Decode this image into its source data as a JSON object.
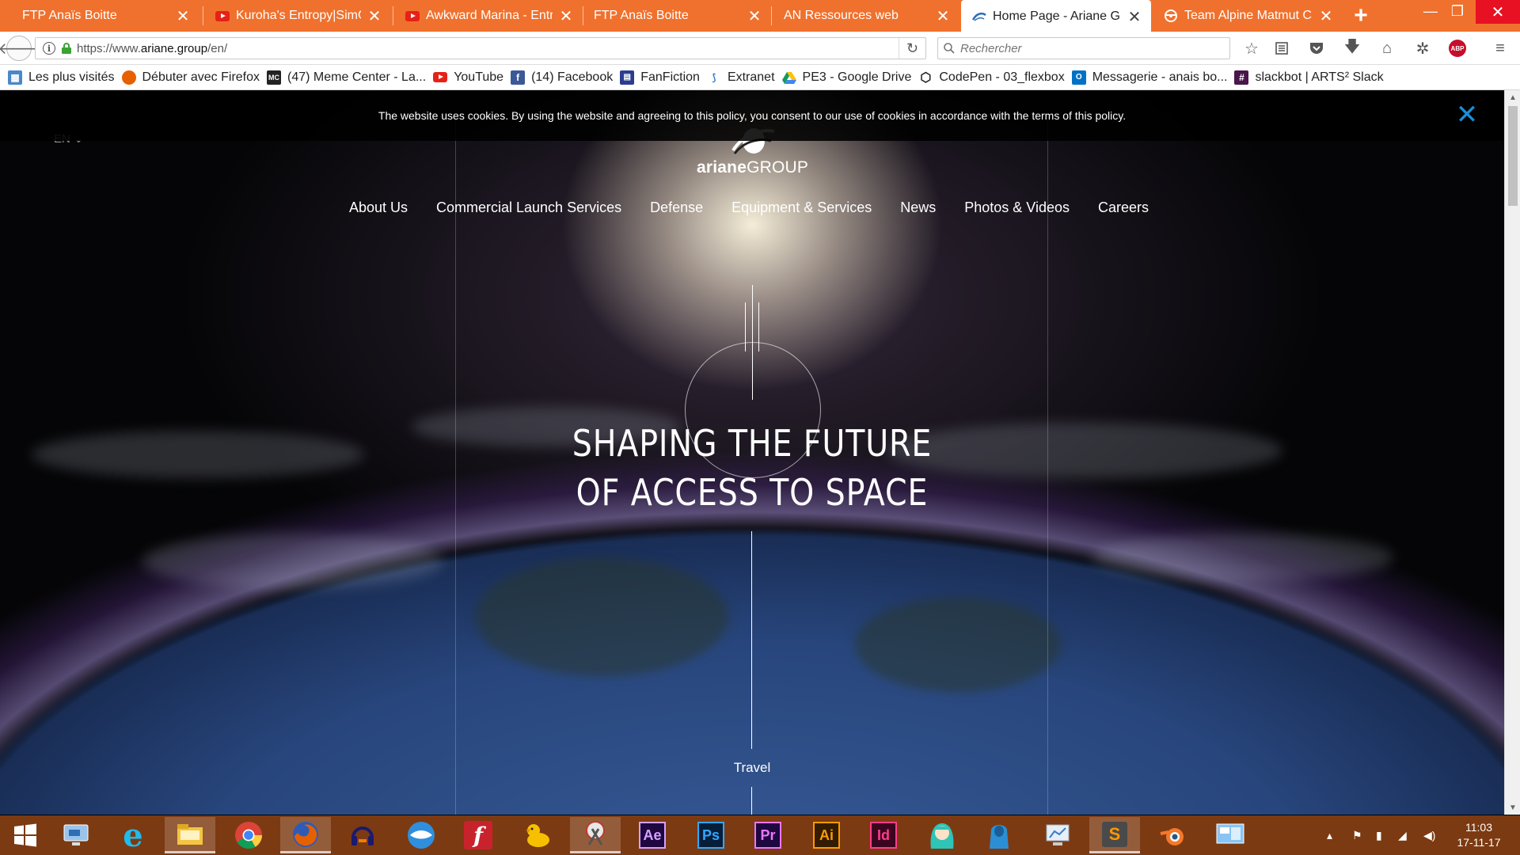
{
  "browser": {
    "tabs": [
      {
        "title": "FTP Anaïs Boitte",
        "favicon": "none"
      },
      {
        "title": "Kuroha's Entropy|SimGr",
        "favicon": "youtube-icon"
      },
      {
        "title": "Awkward Marina - Entro",
        "favicon": "youtube-icon"
      },
      {
        "title": "FTP Anaïs Boitte",
        "favicon": "none"
      },
      {
        "title": "AN Ressources web",
        "favicon": "none"
      },
      {
        "title": "Home Page - Ariane Gro",
        "favicon": "ariane-icon",
        "active": true
      },
      {
        "title": "Team Alpine Matmut Ch",
        "favicon": "steering-wheel-icon"
      }
    ],
    "url_prefix": "https://www.",
    "url_host": "ariane.group",
    "url_path": "/en/",
    "search_placeholder": "Rechercher",
    "bookmarks": [
      {
        "label": "Les plus visités",
        "icon": "most-visited-icon"
      },
      {
        "label": "Débuter avec Firefox",
        "icon": "firefox-icon"
      },
      {
        "label": "(47) Meme Center - La...",
        "icon": "memecenter-icon"
      },
      {
        "label": "YouTube",
        "icon": "youtube-icon"
      },
      {
        "label": "(14) Facebook",
        "icon": "facebook-icon"
      },
      {
        "label": "FanFiction",
        "icon": "fanfiction-icon"
      },
      {
        "label": "Extranet",
        "icon": "extranet-icon"
      },
      {
        "label": "PE3 - Google Drive",
        "icon": "google-drive-icon"
      },
      {
        "label": "CodePen - 03_flexbox",
        "icon": "codepen-icon"
      },
      {
        "label": "Messagerie - anais bo...",
        "icon": "outlook-icon"
      },
      {
        "label": "slackbot | ARTS² Slack",
        "icon": "slack-icon"
      }
    ]
  },
  "page": {
    "cookie_text": "The website uses cookies. By using the website and agreeing to this policy, you consent to our use of cookies in accordance with the terms of this policy.",
    "lang": "EN",
    "logo_bold": "ariane",
    "logo_thin": "GROUP",
    "nav": [
      "About Us",
      "Commercial Launch Services",
      "Defense",
      "Equipment & Services",
      "News",
      "Photos & Videos",
      "Careers"
    ],
    "hero_line1": "SHAPING THE FUTURE",
    "hero_line2": "OF ACCESS TO SPACE",
    "travel_label": "Travel"
  },
  "taskbar": {
    "apps": [
      "windows-start-icon",
      "remote-desktop-icon",
      "internet-explorer-icon",
      "file-explorer-icon",
      "chrome-icon",
      "firefox-icon",
      "audacity-icon",
      "filezilla-icon",
      "flash-icon",
      "cyberduck-icon",
      "snipping-tool-icon",
      "after-effects-icon",
      "photoshop-icon",
      "premiere-icon",
      "illustrator-icon",
      "indesign-icon",
      "miku-icon",
      "hoodie-icon",
      "network-icon",
      "sublime-text-icon",
      "blender-icon",
      "control-panel-icon"
    ],
    "adobe_labels": {
      "ae": "Ae",
      "ps": "Ps",
      "pr": "Pr",
      "ai": "Ai",
      "id": "Id"
    },
    "time": "11:03",
    "date": "17-11-17"
  }
}
